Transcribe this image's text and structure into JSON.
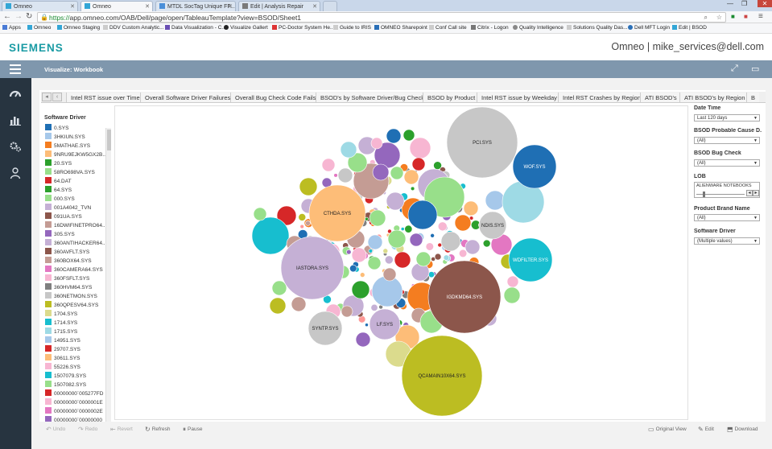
{
  "browser": {
    "tabs": [
      {
        "title": "Omneo",
        "active": false,
        "fav": "#33a6d6"
      },
      {
        "title": "Omneo",
        "active": true,
        "fav": "#33a6d6"
      },
      {
        "title": "MTDL SocTag Unique FF...",
        "active": false,
        "fav": "#4a8fd9"
      },
      {
        "title": "Edit | Analysis Repair",
        "active": false,
        "fav": "#7a7a7a"
      }
    ],
    "url_scheme": "https://",
    "url_rest": "app.omneo.com/OAB/Dell/page/open/TableauTemplate?view=BSOD/Sheet1",
    "bookmarks": [
      "Apps",
      "Omneo",
      "Omneo Staging",
      "DDV Custom Analytic...",
      "Data Visualization - C...",
      "Visualize Gallert",
      "PC-Doctor System He...",
      "Guide to IRIS",
      "OMNEO Sharepoint",
      "Conf Call site",
      "Citrix - Logon",
      "Quality Intelligence",
      "Solutions Quality Das...",
      "Dell MFT Login",
      "Edit | BSOD"
    ]
  },
  "app": {
    "logo": "SIEMENS",
    "user": "Omneo | mike_services@dell.com",
    "page_title": "Visualize: Workbook"
  },
  "sheet_tabs": [
    "Intel RST issue over Time",
    "Overall Software Driver Failures",
    "Overall Bug Check Code Fails",
    "BSOD's by Software Driver/Bug Check",
    "BSOD by Product",
    "Intel RST issue by Weekday",
    "Intel RST Crashes by Region",
    "ATI BSOD's",
    "ATI BSOD's by Region",
    "B"
  ],
  "legend": {
    "title": "Software Driver",
    "items": [
      {
        "label": "0.SYS",
        "color": "#1f6fb4"
      },
      {
        "label": "3HKIUN.SYS",
        "color": "#a6c8ea"
      },
      {
        "label": "5MATHAE.SYS",
        "color": "#f47d20"
      },
      {
        "label": "9NRU9EJKW5GX2B...",
        "color": "#fdbd78"
      },
      {
        "label": "20.SYS",
        "color": "#2ca02c"
      },
      {
        "label": "58RO698VA.SYS",
        "color": "#98df8a"
      },
      {
        "label": "64.DAT",
        "color": "#d62728"
      },
      {
        "label": "64.SYS",
        "color": "#2ca02c"
      },
      {
        "label": "000.SYS",
        "color": "#98df8a"
      },
      {
        "label": "001A4042_TVN",
        "color": "#c5b0d5"
      },
      {
        "label": "091UA.SYS",
        "color": "#8c564b"
      },
      {
        "label": "16DWIFINETPRO64....",
        "color": "#c49c94"
      },
      {
        "label": "305.SYS",
        "color": "#9467bd"
      },
      {
        "label": "360ANTIHACKER64...",
        "color": "#c5b0d5"
      },
      {
        "label": "360AVFLT.SYS",
        "color": "#8c564b"
      },
      {
        "label": "360BOX64.SYS",
        "color": "#c49c94"
      },
      {
        "label": "360CAMERA64.SYS",
        "color": "#e377c2"
      },
      {
        "label": "360FSFLT.SYS",
        "color": "#f7b6d2"
      },
      {
        "label": "360HVM64.SYS",
        "color": "#7f7f7f"
      },
      {
        "label": "360NETMON.SYS",
        "color": "#c7c7c7"
      },
      {
        "label": "360QPESV64.SYS",
        "color": "#bcbd22"
      },
      {
        "label": "1704.SYS",
        "color": "#dbdb8d"
      },
      {
        "label": "1714.SYS",
        "color": "#17becf"
      },
      {
        "label": "1715.SYS",
        "color": "#9edae5"
      },
      {
        "label": "14951.SYS",
        "color": "#a6c8ea"
      },
      {
        "label": "29707.SYS",
        "color": "#d62728"
      },
      {
        "label": "30611.SYS",
        "color": "#fdbd78"
      },
      {
        "label": "55226.SYS",
        "color": "#f7b6d2"
      },
      {
        "label": "1507079.SYS",
        "color": "#17becf"
      },
      {
        "label": "1507082.SYS",
        "color": "#98df8a"
      },
      {
        "label": "00000000`005277FD",
        "color": "#d62728"
      },
      {
        "label": "00000000`0000001E",
        "color": "#f7b6d2"
      },
      {
        "label": "00000000`0000002E",
        "color": "#e377c2"
      },
      {
        "label": "00000000`00000000",
        "color": "#9467bd"
      }
    ]
  },
  "chart_data": {
    "type": "bubble",
    "title": "",
    "labeled_bubbles": [
      {
        "label": "PCI.SYS",
        "color": "#c7c7c7",
        "size_rank": 2
      },
      {
        "label": "WOF.SYS",
        "color": "#1f6fb4",
        "size_rank": 10
      },
      {
        "label": "CTHDA.SYS",
        "color": "#fdbd78",
        "size_rank": 5
      },
      {
        "label": "NDIS.SYS",
        "color": "#c7c7c7",
        "size_rank": 12
      },
      {
        "label": "IASTORA.SYS",
        "color": "#c5b0d5",
        "size_rank": 3
      },
      {
        "label": "WDFILTER.SYS",
        "color": "#17becf",
        "size_rank": 11
      },
      {
        "label": "IGDKMD64.SYS",
        "color": "#8c564b",
        "size_rank": 4
      },
      {
        "label": "SYNTP.SYS",
        "color": "#c7c7c7",
        "size_rank": 13
      },
      {
        "label": "LF.SYS",
        "color": "#c5b0d5",
        "size_rank": 14
      },
      {
        "label": "QCAMAIN10X64.SYS",
        "color": "#bcbd22",
        "size_rank": 1
      }
    ]
  },
  "filters": {
    "date_time": {
      "label": "Date Time",
      "value": "Last 120 days"
    },
    "bsod_cause": {
      "label": "BSOD Probable Cause D...",
      "value": "(All)"
    },
    "bsod_bug_check": {
      "label": "BSOD Bug Check",
      "value": "(All)"
    },
    "lob": {
      "label": "LOB",
      "value": "ALIENWARE NOTEBOOKS"
    },
    "product_brand": {
      "label": "Product Brand Name",
      "value": "(All)"
    },
    "software_driver": {
      "label": "Software Driver",
      "value": "(Multiple values)"
    }
  },
  "toolbar": {
    "undo": "Undo",
    "redo": "Redo",
    "revert": "Revert",
    "refresh": "Refresh",
    "pause": "Pause",
    "original_view": "Original View",
    "edit": "Edit",
    "download": "Download"
  }
}
